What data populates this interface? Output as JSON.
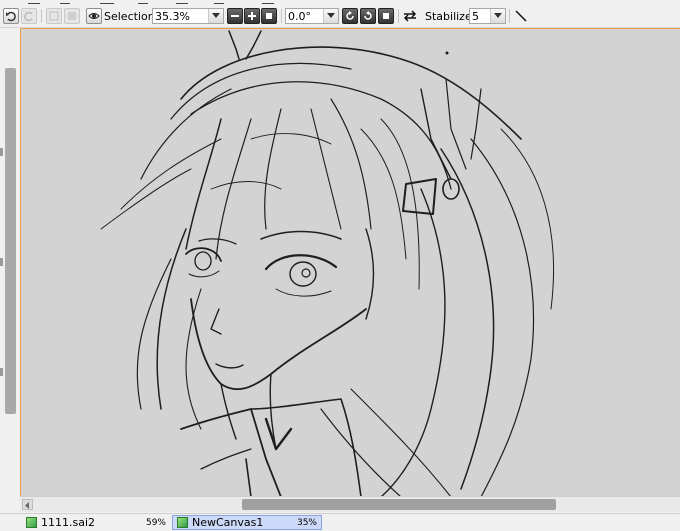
{
  "toolbar": {
    "selection_label": "Selection",
    "zoom_value": "35.3%",
    "rotation_value": "0.0°",
    "stabilizer_label": "Stabilizer",
    "stabilizer_value": "5",
    "icons": [
      "undo-icon",
      "redo-icon",
      "deselect-icon",
      "invert-icon",
      "eye-icon",
      "zoom-out-icon",
      "zoom-in-icon",
      "zoom-reset-icon",
      "rotate-ccw-icon",
      "rotate-cw-icon",
      "rotate-reset-icon",
      "flip-horizontal-icon",
      "line-tool-icon"
    ]
  },
  "documents": [
    {
      "name": "1111.sai2",
      "zoom": "59%",
      "active": false
    },
    {
      "name": "NewCanvas1",
      "zoom": "35%",
      "active": true
    }
  ],
  "colors": {
    "canvas_bg": "#d3d3d3",
    "active_tab": "#ccd9f8",
    "canvas_border": "#e8a04a",
    "scroll_thumb": "#a0a0a0"
  }
}
